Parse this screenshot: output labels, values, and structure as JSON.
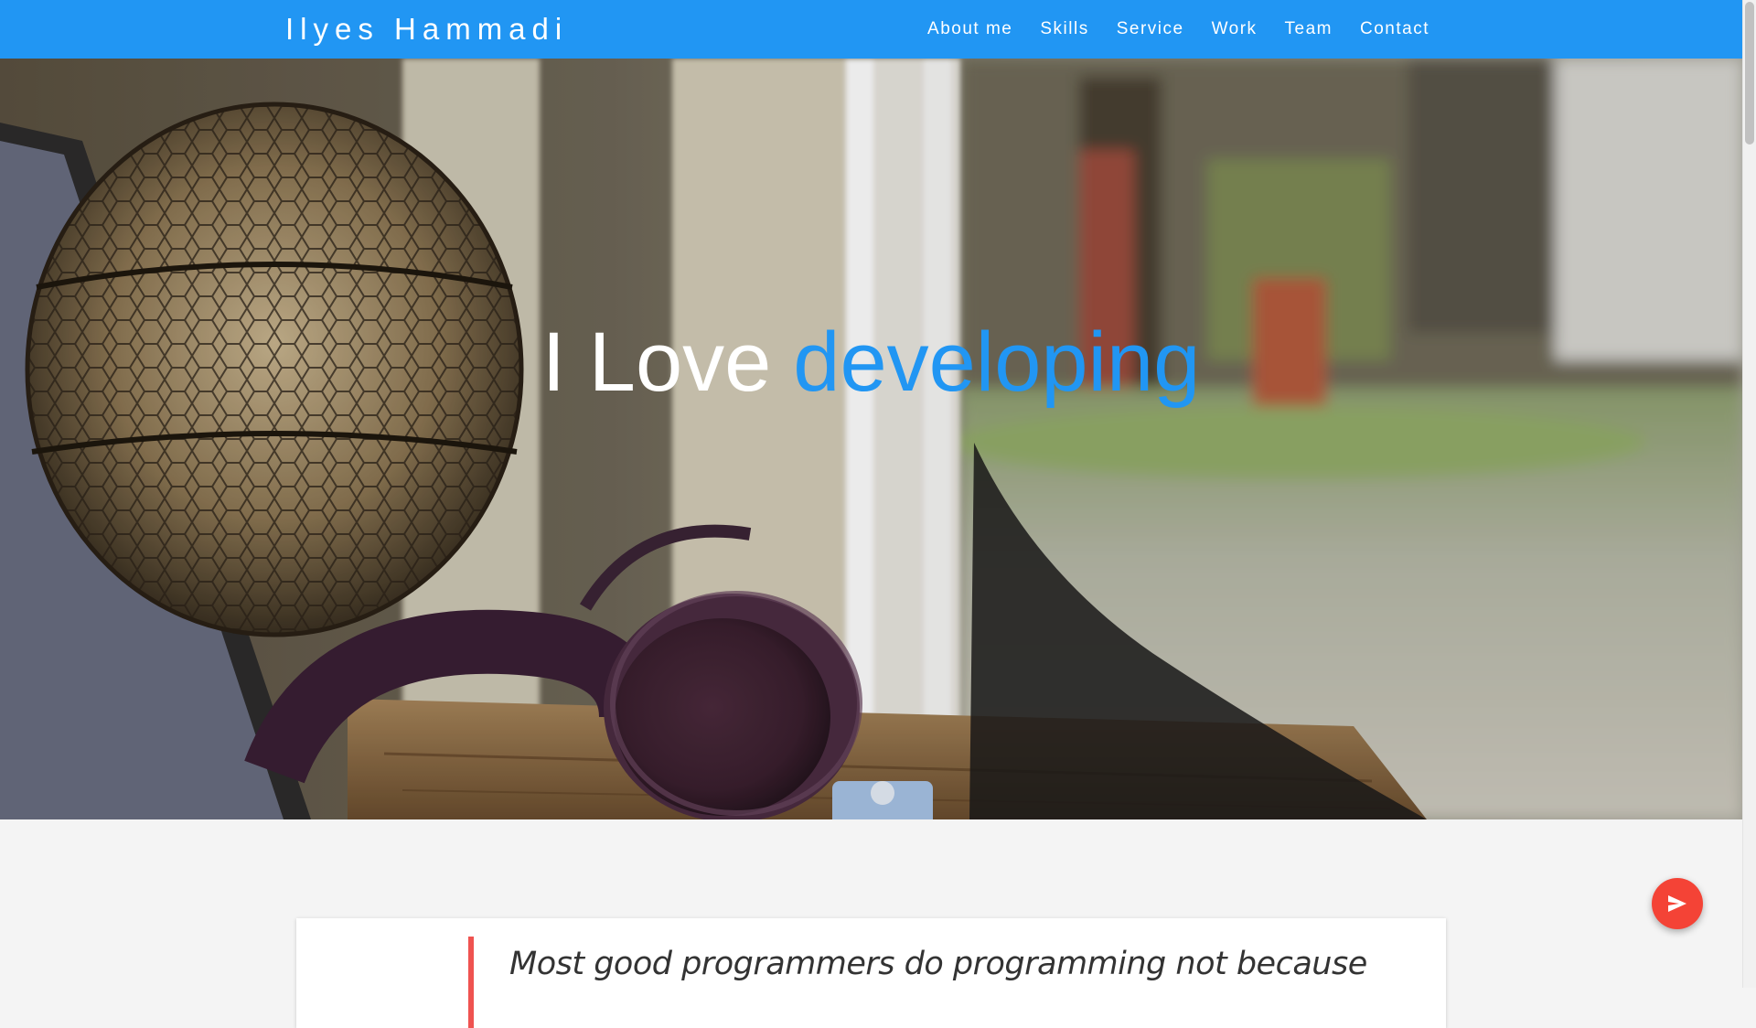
{
  "nav": {
    "brand": "Ilyes Hammadi",
    "links": [
      {
        "label": "About me"
      },
      {
        "label": "Skills"
      },
      {
        "label": "Service"
      },
      {
        "label": "Work"
      },
      {
        "label": "Team"
      },
      {
        "label": "Contact"
      }
    ]
  },
  "hero": {
    "heading_lead": "I Love",
    "heading_accent": "developing"
  },
  "quote": {
    "text": "Most good programmers do programming not because"
  },
  "fab": {
    "icon": "send-icon"
  },
  "colors": {
    "primary": "#2196f3",
    "accent_red": "#f44336",
    "quote_bar": "#ef5350",
    "page_bg": "#f4f4f4"
  }
}
